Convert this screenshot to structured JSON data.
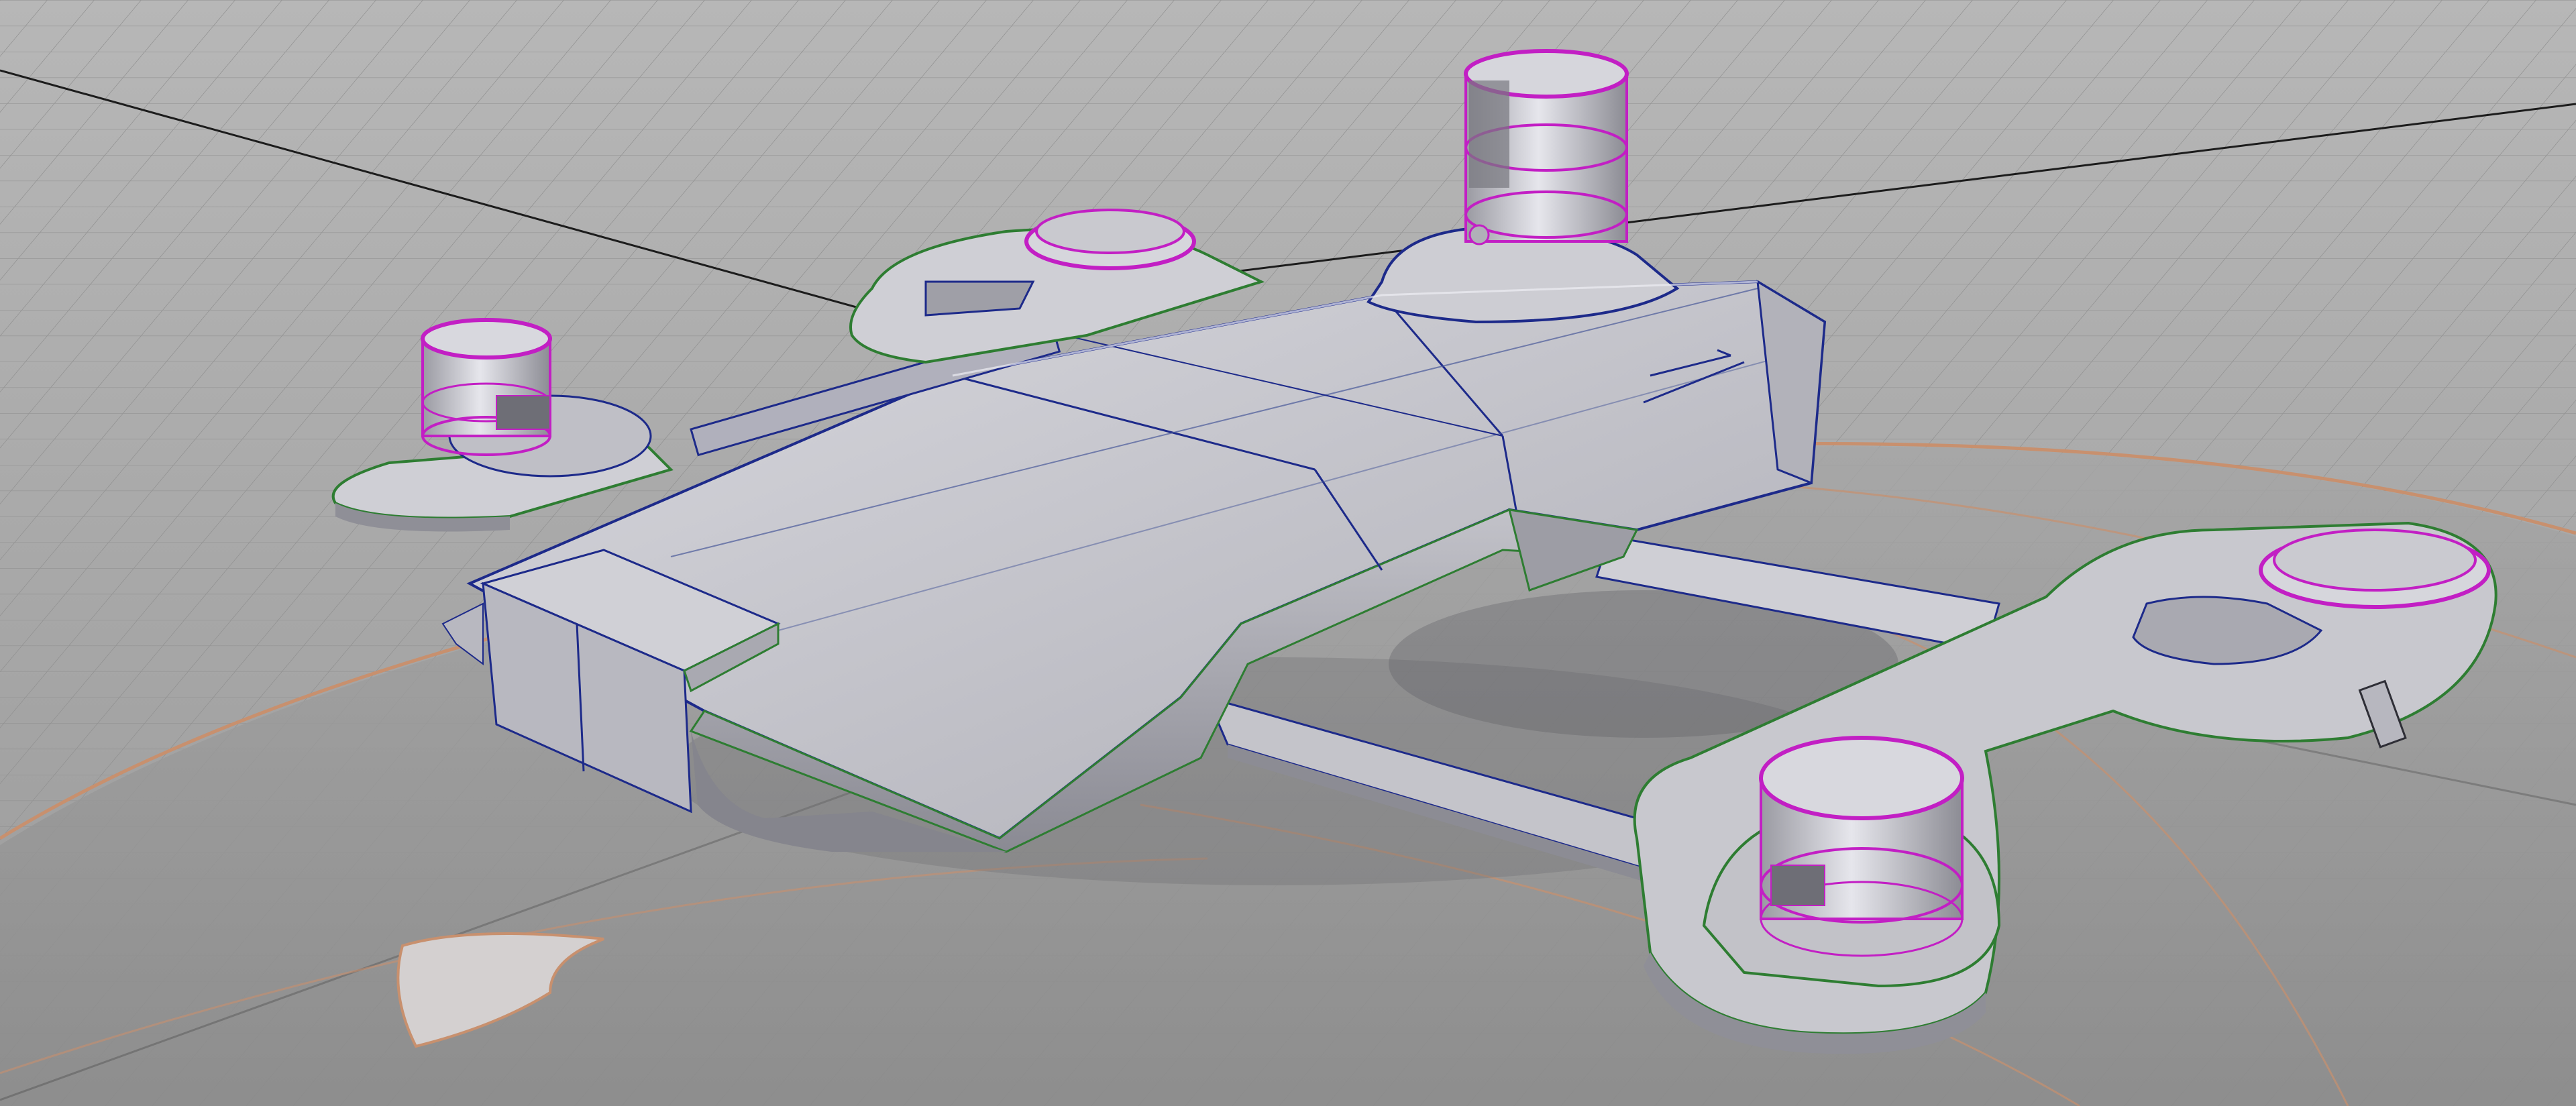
{
  "viewport": {
    "kind": "3d-modeling-viewport",
    "display_mode": "shaded-with-edges",
    "colors": {
      "background": "#b3b3b3",
      "grid_line": "#8e8e8e",
      "world_axis": "#1c1c1c",
      "model_surface": "#c6c6cc",
      "model_shadow": "#7f7f86",
      "edge_dark_blue": "#1d2a8a",
      "edge_green": "#2e7d32",
      "edge_magenta": "#c21fc4",
      "ground_surface": "#9a9a9a",
      "ground_edge_orange": "#c8906e"
    },
    "objects": [
      {
        "name": "drone-body",
        "selected": false
      },
      {
        "name": "front-left-motor-pod",
        "selected": true
      },
      {
        "name": "rear-left-motor-pod",
        "selected": true
      },
      {
        "name": "rear-right-motor-pod",
        "selected": true
      },
      {
        "name": "front-right-motor-pod",
        "selected": true
      },
      {
        "name": "landing-crossbars",
        "selected": false
      },
      {
        "name": "ground-surface",
        "selected": false
      }
    ]
  }
}
